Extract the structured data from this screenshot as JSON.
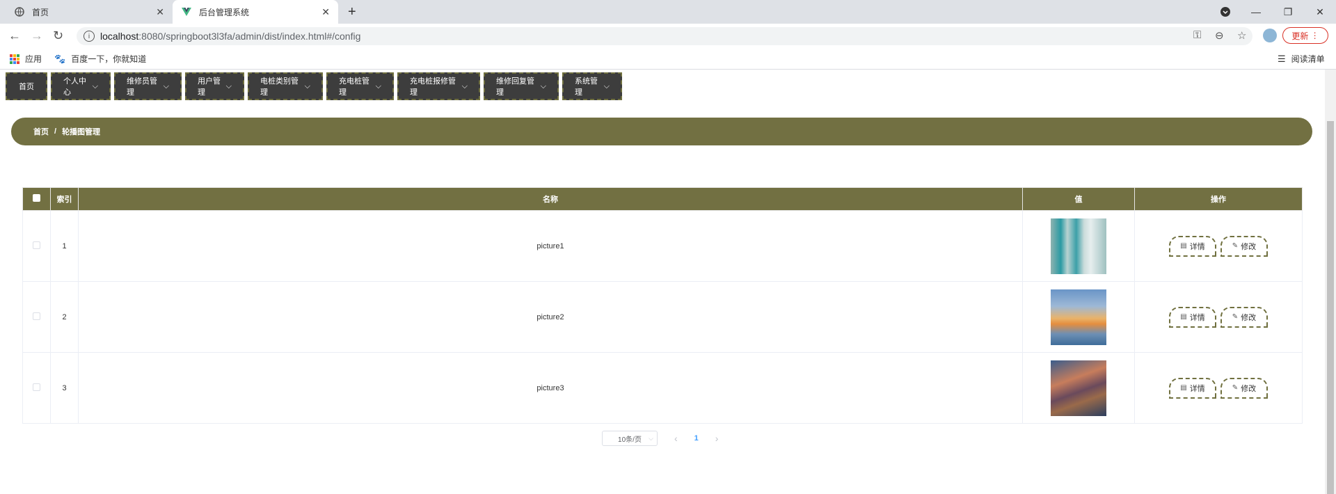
{
  "browser": {
    "tabs": [
      {
        "title": "首页"
      },
      {
        "title": "后台管理系统"
      }
    ],
    "url_host": "localhost",
    "url_rest": ":8080/springboot3l3fa/admin/dist/index.html#/config",
    "update_label": "更新",
    "bookmarks": {
      "apps": "应用",
      "baidu": "百度一下，你就知道",
      "reading_list": "阅读清单"
    }
  },
  "menu": {
    "items": [
      {
        "label": "首页"
      },
      {
        "label": "个人中心"
      },
      {
        "label": "维修员管理"
      },
      {
        "label": "用户管理"
      },
      {
        "label": "电桩类别管理"
      },
      {
        "label": "充电桩管理"
      },
      {
        "label": "充电桩报修管理"
      },
      {
        "label": "维修回复管理"
      },
      {
        "label": "系统管理"
      }
    ]
  },
  "breadcrumb": {
    "home": "首页",
    "separator": "/",
    "current": "轮播图管理"
  },
  "table": {
    "headers": {
      "index": "索引",
      "name": "名称",
      "value": "值",
      "actions": "操作"
    },
    "rows": [
      {
        "index": "1",
        "name": "picture1"
      },
      {
        "index": "2",
        "name": "picture2"
      },
      {
        "index": "3",
        "name": "picture3"
      }
    ],
    "detail_label": "详情",
    "edit_label": "修改"
  },
  "pagination": {
    "page_size": "10条/页",
    "current_page": "1"
  },
  "colors": {
    "theme": "#727042",
    "menu_bg": "#3d3d3d",
    "accent": "#409eff"
  }
}
